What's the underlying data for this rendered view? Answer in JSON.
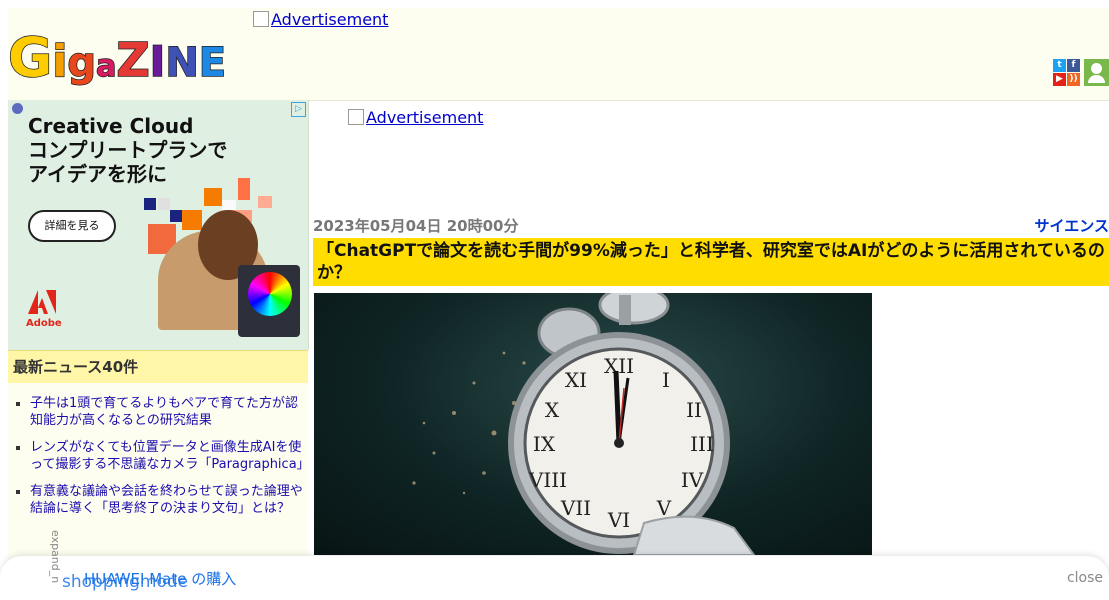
{
  "header": {
    "logo_text": "GIGAZINE",
    "top_ad_alt": "Advertisement",
    "social": {
      "twitter": "t",
      "facebook": "f",
      "youtube": "▶",
      "rss": "))"
    }
  },
  "sidebar_ad": {
    "headline_line1": "Creative Cloud",
    "headline_line2": "コンプリートプランで",
    "headline_line3": "アイデアを形に",
    "button_label": "詳細を見る",
    "brand": "Adobe"
  },
  "latest_news": {
    "heading": "最新ニュース40件",
    "items": [
      {
        "title": "子牛は1頭で育てるよりもペアで育てた方が認知能力が高くなるとの研究結果"
      },
      {
        "title": "レンズがなくても位置データと画像生成AIを使って撮影する不思議なカメラ「Paragraphica」"
      },
      {
        "title": "有意義な議論や会話を終わらせて誤った論理や結論に導く「思考終了の決まり文句」とは？"
      }
    ]
  },
  "article": {
    "main_ad_alt": "Advertisement",
    "date": "2023年05月04日 20時00分",
    "category": "サイエンス",
    "title": "「ChatGPTで論文を読む手間が99%減った」と科学者、研究室ではAIがどのように活用されているのか？"
  },
  "bottom_bar": {
    "product_text": "HUAWEI Mate の購入",
    "overlay_text": "shoppingmode",
    "vertical_text": "expand_n",
    "close_label": "close"
  }
}
